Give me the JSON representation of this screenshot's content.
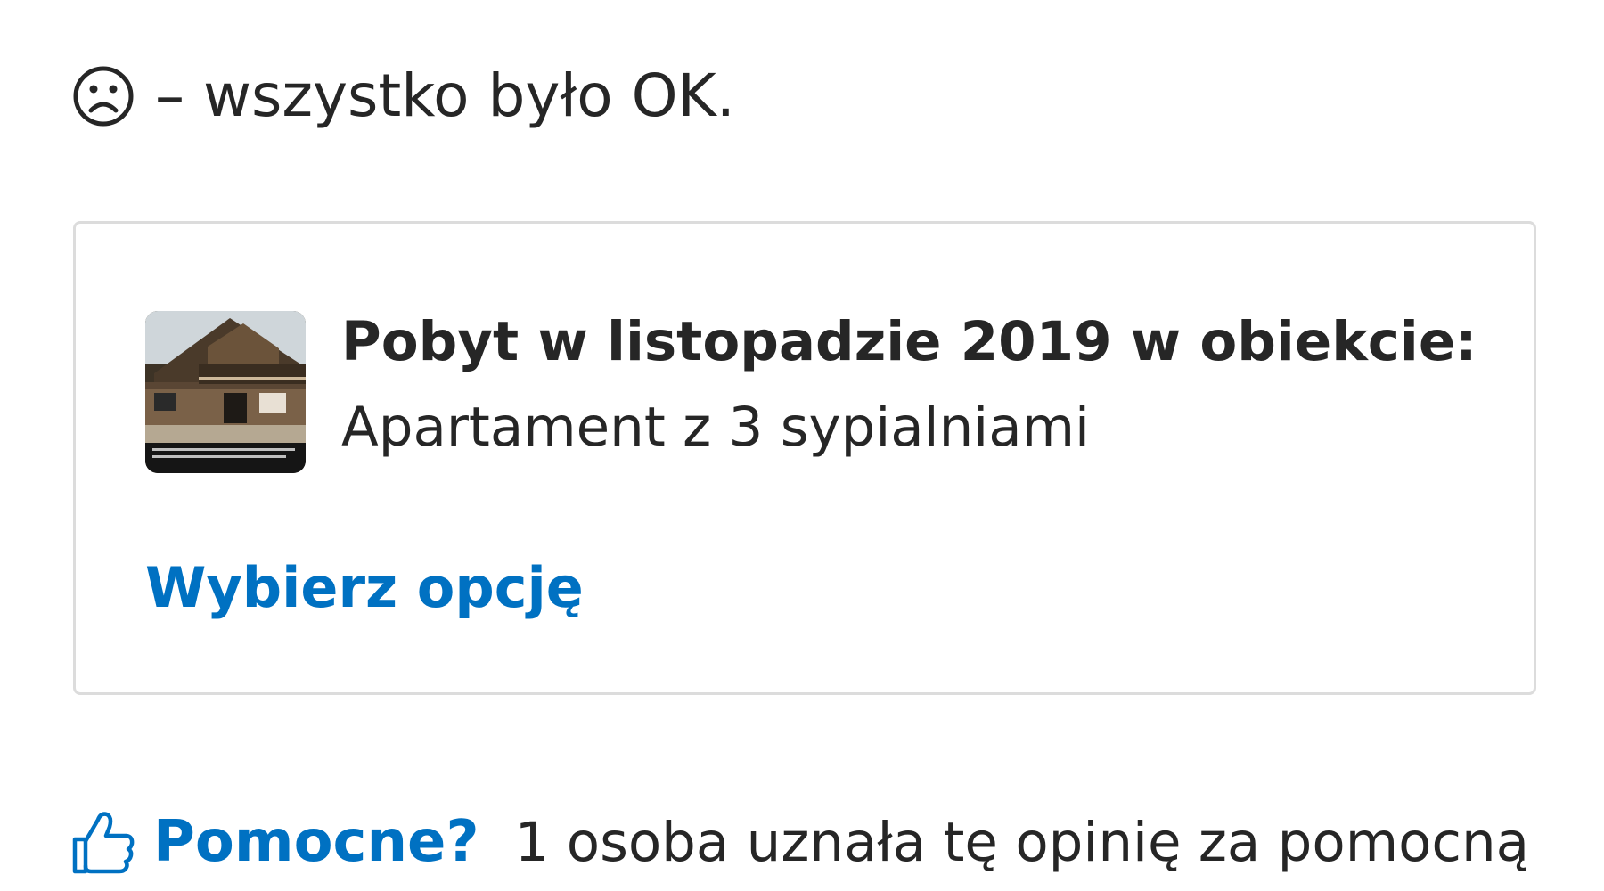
{
  "review": {
    "icon": "sad-face-icon",
    "negative_text": "– wszystko było OK."
  },
  "stay_card": {
    "thumbnail_icon": "property-photo",
    "title": "Pobyt w listopadzie 2019 w obiekcie:",
    "room": "Apartament z 3 sypialniami",
    "choose_option_label": "Wybierz opcję"
  },
  "helpful": {
    "icon": "thumbs-up-icon",
    "label": "Pomocne?",
    "count_text": "1 osoba uznała tę opinię za pomocną"
  },
  "colors": {
    "link_blue": "#0071c2",
    "text": "#262626",
    "card_border": "#dcdcdc"
  }
}
